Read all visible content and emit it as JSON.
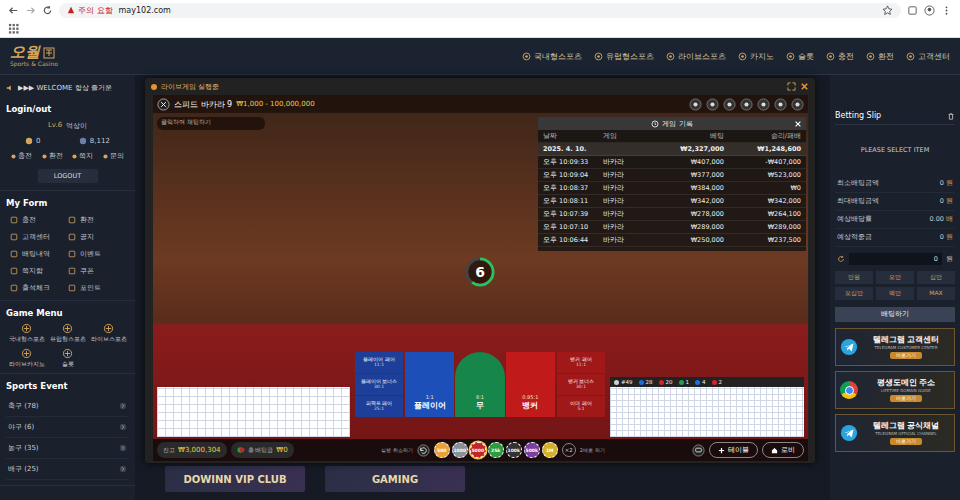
{
  "browser": {
    "warning": "주의 요함",
    "url": "may102.com"
  },
  "header": {
    "logo": "오월",
    "tagline": "Sports & Casino",
    "nav": [
      "국내형스포츠",
      "유럽형스포츠",
      "라이브스포츠",
      "카지노",
      "슬롯",
      "충전",
      "환전",
      "고객센터"
    ]
  },
  "notice": "▶▶▶ WELCOME 항상 즐거운",
  "login": {
    "title": "Login/out",
    "level": "Lv.6",
    "name": "억상이",
    "money": "0",
    "point": "8,112",
    "buttons": [
      "충전",
      "환전",
      "쪽지",
      "문의"
    ],
    "logout": "LOGOUT"
  },
  "my_form": {
    "title": "My Form",
    "items": [
      "충전",
      "환전",
      "고객센터",
      "공지",
      "배팅내역",
      "이벤트",
      "쪽지함",
      "쿠폰",
      "출석체크",
      "포인트"
    ]
  },
  "game_menu": {
    "title": "Game Menu",
    "items": [
      "국내형스포츠",
      "유럽형스포츠",
      "라이브스포츠",
      "라이브카지노",
      "슬롯"
    ]
  },
  "sports_event": {
    "title": "Sports Event",
    "items": [
      "축구 (78)",
      "야구 (6)",
      "농구 (35)",
      "배구 (25)"
    ]
  },
  "modal": {
    "title": "라이브게임 실행중"
  },
  "game": {
    "name": "스피드 바카라 9",
    "limits": "₩1,000 - 100,000,000",
    "chat_placeholder": "클릭하여 채팅하기",
    "countdown": {
      "value": "6",
      "level": 0.6
    },
    "history": {
      "title": "게임 기록",
      "columns": [
        "날짜",
        "게임",
        "베팅",
        "승리/패배"
      ],
      "rows": [
        {
          "date": "2025. 4. 10.",
          "game": "",
          "bet": "₩2,327,000",
          "result": "₩1,248,600",
          "kind": "summary"
        },
        {
          "date": "오후 10:09:33",
          "game": "바카라",
          "bet": "₩407,000",
          "result": "-₩407,000",
          "kind": "entry"
        },
        {
          "date": "오후 10:09:04",
          "game": "바카라",
          "bet": "₩377,000",
          "result": "₩523,000",
          "kind": "entry"
        },
        {
          "date": "오후 10:08:37",
          "game": "바카라",
          "bet": "₩384,000",
          "result": "₩0",
          "kind": "entry"
        },
        {
          "date": "오후 10:08:11",
          "game": "바카라",
          "bet": "₩342,000",
          "result": "₩342,000",
          "kind": "entry"
        },
        {
          "date": "오후 10:07:39",
          "game": "바카라",
          "bet": "₩278,000",
          "result": "₩264,100",
          "kind": "entry"
        },
        {
          "date": "오후 10:07:10",
          "game": "바카라",
          "bet": "₩289,000",
          "result": "₩289,000",
          "kind": "entry"
        },
        {
          "date": "오후 10:06:44",
          "game": "바카라",
          "bet": "₩250,000",
          "result": "₩237,500",
          "kind": "entry"
        }
      ]
    },
    "side_bets_left": [
      {
        "label": "플레이어 페어",
        "payout": "11:1"
      },
      {
        "label": "플레이어 보너스",
        "payout": "30:1"
      },
      {
        "label": "퍼펙트 페어",
        "payout": "25:1"
      }
    ],
    "main_bets": [
      {
        "label": "플레이어",
        "payout": "1:1",
        "color": "#1d4fb8"
      },
      {
        "label": "무",
        "payout": "8:1",
        "color": "#17864a"
      },
      {
        "label": "뱅커",
        "payout": "0.95:1",
        "color": "#c01a1a"
      }
    ],
    "side_bets_right": [
      {
        "label": "뱅커 페어",
        "payout": "11:1"
      },
      {
        "label": "뱅커 보너스",
        "payout": "30:1"
      },
      {
        "label": "이더 페어",
        "payout": "5:1"
      }
    ],
    "road_stats": [
      {
        "text": "#49",
        "color": "#cfcfcf"
      },
      {
        "text": "28",
        "color": "#1d6fe0"
      },
      {
        "text": "20",
        "color": "#d62424"
      },
      {
        "text": "1",
        "color": "#22a050"
      },
      {
        "text": "4",
        "color": "#1d6fe0"
      },
      {
        "text": "2",
        "color": "#d62424"
      }
    ],
    "balance": {
      "label": "잔고",
      "value": "₩3,000,304"
    },
    "total_bet": {
      "label": "총 배팅금",
      "value": "₩0"
    },
    "undo_label": "실행 취소하기",
    "chips": [
      {
        "value": "500",
        "color": "#e9a23b",
        "selected": false
      },
      {
        "value": "1000",
        "color": "#8a8f98",
        "selected": false
      },
      {
        "value": "5000",
        "color": "#c0262b",
        "selected": true
      },
      {
        "value": "25k",
        "color": "#2e9b3e",
        "selected": false
      },
      {
        "value": "100k",
        "color": "#333333",
        "selected": false
      },
      {
        "value": "500k",
        "color": "#7b3fa0",
        "selected": false
      },
      {
        "value": "1M",
        "color": "#d4b12c",
        "selected": false
      }
    ],
    "double": {
      "symbol": "×2",
      "label": "2배로 하기"
    },
    "table_button": "테이블",
    "lobby_button": "로비"
  },
  "betting_slip": {
    "title": "Betting Slip",
    "placeholder": "PLEASE SELECT ITEM",
    "rows": [
      {
        "label": "최소배팅금액",
        "value": "0",
        "unit": "원"
      },
      {
        "label": "최대배팅금액",
        "value": "0",
        "unit": "원"
      },
      {
        "label": "예상배당률",
        "value": "0.00",
        "unit": "배"
      },
      {
        "label": "예상적중금",
        "value": "0",
        "unit": "원"
      }
    ],
    "amount": "0",
    "amount_unit": "원",
    "quick": [
      "만원",
      "오만",
      "십만",
      "오십만",
      "백만",
      "MAX"
    ],
    "submit": "배팅하기"
  },
  "banners_right": [
    {
      "title": "텔레그램 고객센터",
      "subtitle": "TELEGRAM CUSTOMER CENTER",
      "button": "바로가기",
      "kind": "telegram"
    },
    {
      "title": "평생도메인 주소",
      "subtitle": "LIFETIME DOMAIN GUIDE",
      "button": "바로가기",
      "kind": "chrome"
    },
    {
      "title": "텔레그램 공식채널",
      "subtitle": "TELEGRAM OFFICIAL CHANNEL",
      "button": "바로가기",
      "kind": "telegram"
    }
  ],
  "banners_bottom": [
    "DOWINN VIP CLUB",
    "GAMING"
  ]
}
